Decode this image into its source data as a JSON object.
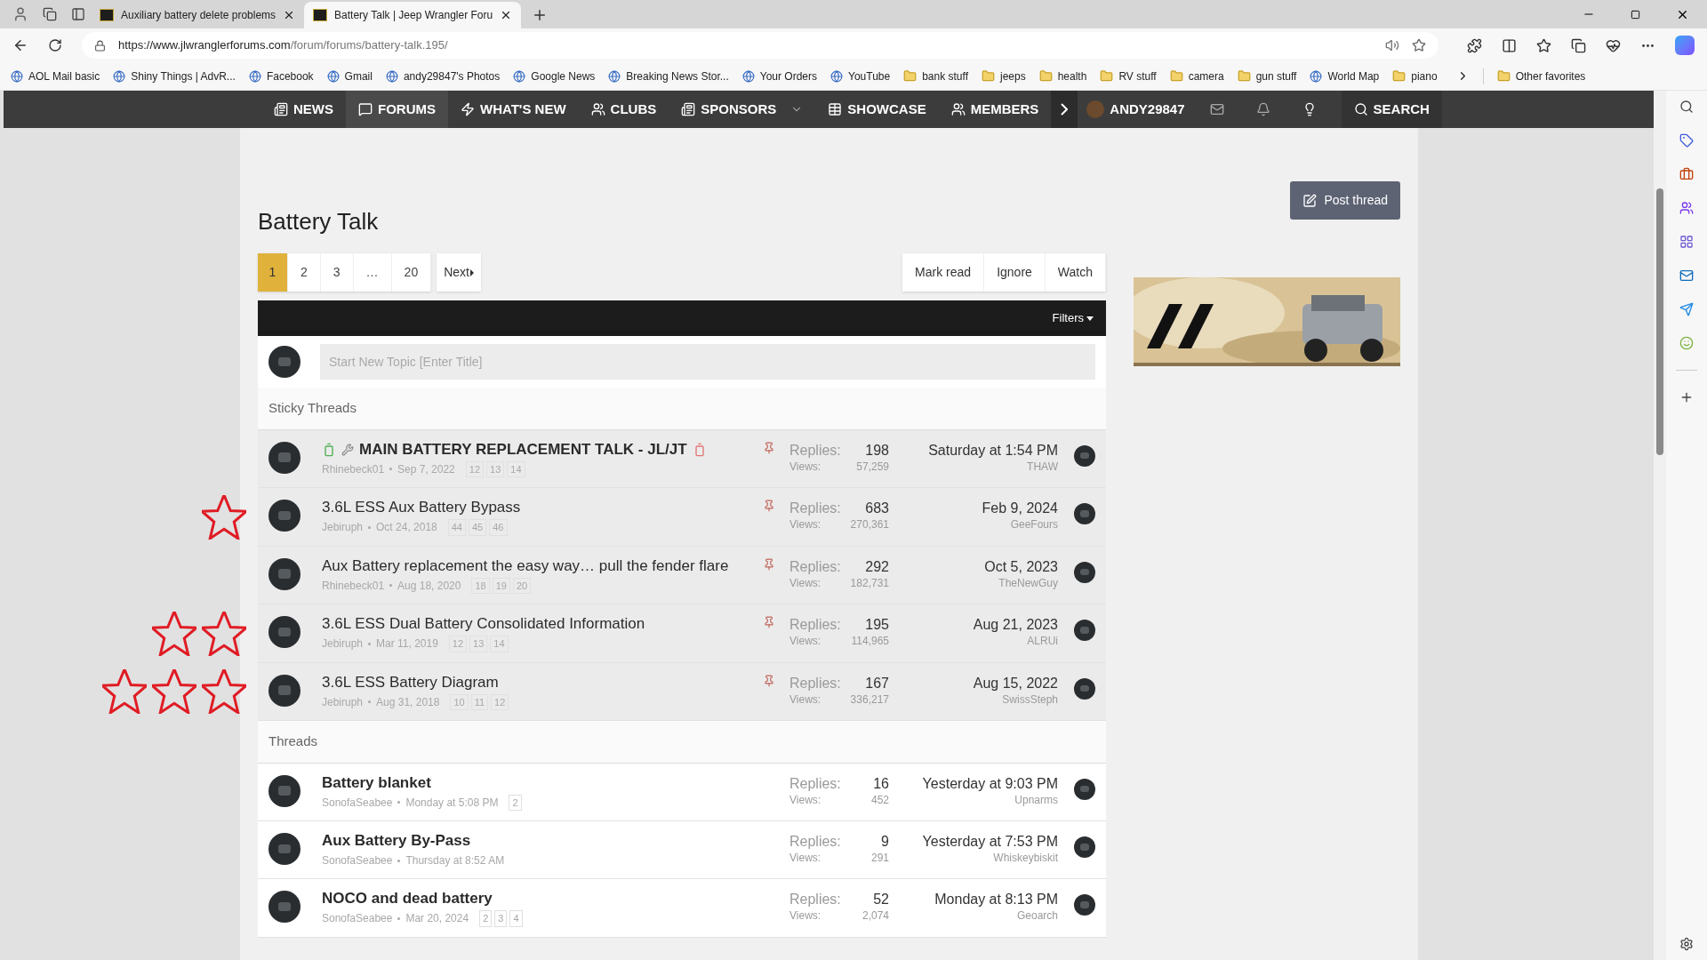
{
  "browser": {
    "tabs": [
      {
        "title": "Auxiliary battery delete problems",
        "selected": false
      },
      {
        "title": "Battery Talk | Jeep Wrangler Foru",
        "selected": true
      }
    ],
    "url_host": "https://www.jlwranglerforums.com",
    "url_path": "/forum/forums/battery-talk.195/",
    "bookmarks": [
      {
        "label": "AOL Mail basic",
        "kind": "site"
      },
      {
        "label": "Shiny Things | AdvR...",
        "kind": "site"
      },
      {
        "label": "Facebook",
        "kind": "site"
      },
      {
        "label": "Gmail",
        "kind": "site"
      },
      {
        "label": "andy29847's Photos",
        "kind": "site"
      },
      {
        "label": "Google News",
        "kind": "site"
      },
      {
        "label": "Breaking News Stor...",
        "kind": "site"
      },
      {
        "label": "Your Orders",
        "kind": "site"
      },
      {
        "label": "YouTube",
        "kind": "site"
      },
      {
        "label": "bank stuff",
        "kind": "folder"
      },
      {
        "label": "jeeps",
        "kind": "folder"
      },
      {
        "label": "health",
        "kind": "folder"
      },
      {
        "label": "RV stuff",
        "kind": "folder"
      },
      {
        "label": "camera",
        "kind": "folder"
      },
      {
        "label": "gun stuff",
        "kind": "folder"
      },
      {
        "label": "World Map",
        "kind": "site"
      },
      {
        "label": "piano",
        "kind": "folder"
      }
    ],
    "other_favorites": "Other favorites"
  },
  "nav": {
    "items": [
      {
        "label": "NEWS",
        "selected": false
      },
      {
        "label": "FORUMS",
        "selected": true
      },
      {
        "label": "WHAT'S NEW",
        "selected": false
      },
      {
        "label": "CLUBS",
        "selected": false
      },
      {
        "label": "SPONSORS",
        "selected": false
      },
      {
        "label": "SHOWCASE",
        "selected": false
      },
      {
        "label": "MEMBERS",
        "selected": false
      }
    ],
    "user": "ANDY29847",
    "search": "SEARCH"
  },
  "forum": {
    "title": "Battery Talk",
    "post_button": "Post thread",
    "pages": [
      {
        "label": "1",
        "selected": true
      },
      {
        "label": "2",
        "selected": false
      },
      {
        "label": "3",
        "selected": false
      },
      {
        "label": "…",
        "selected": false
      },
      {
        "label": "20",
        "selected": false
      }
    ],
    "next": "Next",
    "actions": [
      "Mark read",
      "Ignore",
      "Watch"
    ],
    "filters": "Filters",
    "new_topic_placeholder": "Start New Topic [Enter Title]",
    "sections": [
      {
        "title": "Sticky Threads",
        "kind": "sticky",
        "threads": [
          {
            "title": "MAIN BATTERY REPLACEMENT TALK - JL/JT",
            "unread": true,
            "title_icons": true,
            "author": "Rhinebeck01",
            "date": "Sep 7, 2022",
            "pages": [
              "12",
              "13",
              "14"
            ],
            "pinned": true,
            "replies_label": "Replies:",
            "replies": "198",
            "views_label": "Views:",
            "views": "57,259",
            "last_date": "Saturday at 1:54 PM",
            "last_user": "THAW"
          },
          {
            "title": "3.6L ESS Aux Battery Bypass",
            "unread": false,
            "title_icons": false,
            "author": "Jebiruph",
            "date": "Oct 24, 2018",
            "pages": [
              "44",
              "45",
              "46"
            ],
            "pinned": true,
            "replies_label": "Replies:",
            "replies": "683",
            "views_label": "Views:",
            "views": "270,361",
            "last_date": "Feb 9, 2024",
            "last_user": "GeeFours",
            "annotations": [
              {
                "kind": "star"
              }
            ]
          },
          {
            "title": "Aux Battery replacement the easy way… pull the fender flare",
            "unread": false,
            "title_icons": false,
            "author": "Rhinebeck01",
            "date": "Aug 18, 2020",
            "pages": [
              "18",
              "19",
              "20"
            ],
            "pinned": true,
            "replies_label": "Replies:",
            "replies": "292",
            "views_label": "Views:",
            "views": "182,731",
            "last_date": "Oct 5, 2023",
            "last_user": "TheNewGuy"
          },
          {
            "title": "3.6L ESS Dual Battery Consolidated Information",
            "unread": false,
            "title_icons": false,
            "author": "Jebiruph",
            "date": "Mar 11, 2019",
            "pages": [
              "12",
              "13",
              "14"
            ],
            "pinned": true,
            "replies_label": "Replies:",
            "replies": "195",
            "views_label": "Views:",
            "views": "114,965",
            "last_date": "Aug 21, 2023",
            "last_user": "ALRUi",
            "annotations": [
              {
                "kind": "star"
              },
              {
                "kind": "star"
              }
            ]
          },
          {
            "title": "3.6L ESS Battery Diagram",
            "unread": false,
            "title_icons": false,
            "author": "Jebiruph",
            "date": "Aug 31, 2018",
            "pages": [
              "10",
              "11",
              "12"
            ],
            "pinned": true,
            "replies_label": "Replies:",
            "replies": "167",
            "views_label": "Views:",
            "views": "336,217",
            "last_date": "Aug 15, 2022",
            "last_user": "SwissSteph",
            "annotations": [
              {
                "kind": "star"
              },
              {
                "kind": "star"
              },
              {
                "kind": "star"
              }
            ]
          }
        ]
      },
      {
        "title": "Threads",
        "kind": "normal",
        "threads": [
          {
            "title": "Battery blanket",
            "unread": true,
            "title_icons": false,
            "author": "SonofaSeabee",
            "date": "Monday at 5:08 PM",
            "pages": [
              "2"
            ],
            "pinned": false,
            "replies_label": "Replies:",
            "replies": "16",
            "views_label": "Views:",
            "views": "452",
            "last_date": "Yesterday at 9:03 PM",
            "last_user": "Upnarms"
          },
          {
            "title": "Aux Battery By-Pass",
            "unread": true,
            "title_icons": false,
            "author": "SonofaSeabee",
            "date": "Thursday at 8:52 AM",
            "pinned": false,
            "replies_label": "Replies:",
            "replies": "9",
            "views_label": "Views:",
            "views": "291",
            "last_date": "Yesterday at 7:53 PM",
            "last_user": "Whiskeybiskit"
          },
          {
            "title": "NOCO and dead battery",
            "unread": true,
            "title_icons": false,
            "author": "SonofaSeabee",
            "date": "Mar 20, 2024",
            "pages": [
              "2",
              "3",
              "4"
            ],
            "pinned": false,
            "replies_label": "Replies:",
            "replies": "52",
            "views_label": "Views:",
            "views": "2,074",
            "last_date": "Monday at 8:13 PM",
            "last_user": "Geoarch"
          }
        ]
      }
    ]
  }
}
